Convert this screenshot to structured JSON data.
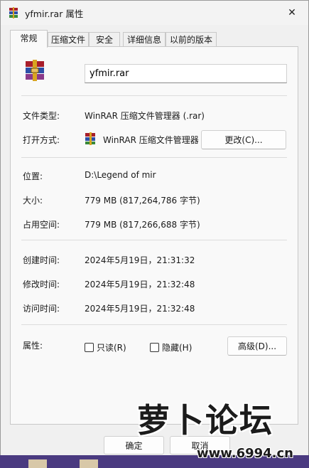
{
  "window": {
    "title": "yfmir.rar 属性",
    "close_glyph": "✕"
  },
  "tabs": [
    {
      "label": "常规",
      "active": true
    },
    {
      "label": "压缩文件"
    },
    {
      "label": "安全"
    },
    {
      "label": "详细信息"
    },
    {
      "label": "以前的版本"
    }
  ],
  "general": {
    "file_name": "yfmir.rar",
    "file_type_label": "文件类型:",
    "file_type_value": "WinRAR 压缩文件管理器 (.rar)",
    "open_with_label": "打开方式:",
    "open_with_value": "WinRAR 压缩文件管理器",
    "change_button": "更改(C)...",
    "location_label": "位置:",
    "location_value": "D:\\Legend of mir",
    "size_label": "大小:",
    "size_value": "779 MB (817,264,786 字节)",
    "disk_size_label": "占用空间:",
    "disk_size_value": "779 MB (817,266,688 字节)",
    "created_label": "创建时间:",
    "created_value": "2024年5月19日，21:31:32",
    "modified_label": "修改时间:",
    "modified_value": "2024年5月19日，21:32:48",
    "accessed_label": "访问时间:",
    "accessed_value": "2024年5月19日，21:32:48",
    "attributes_label": "属性:",
    "readonly_label": "只读(R)",
    "hidden_label": "隐藏(H)",
    "advanced_button": "高级(D)..."
  },
  "footer": {
    "ok_button": "确定",
    "cancel_button": "取消"
  },
  "watermark": {
    "brand": "萝卜论坛",
    "url": "www.6994.cn"
  },
  "colors": {
    "winrar_red": "#a81e2b",
    "winrar_blue": "#2d4fa8",
    "winrar_gold": "#d9a520"
  }
}
